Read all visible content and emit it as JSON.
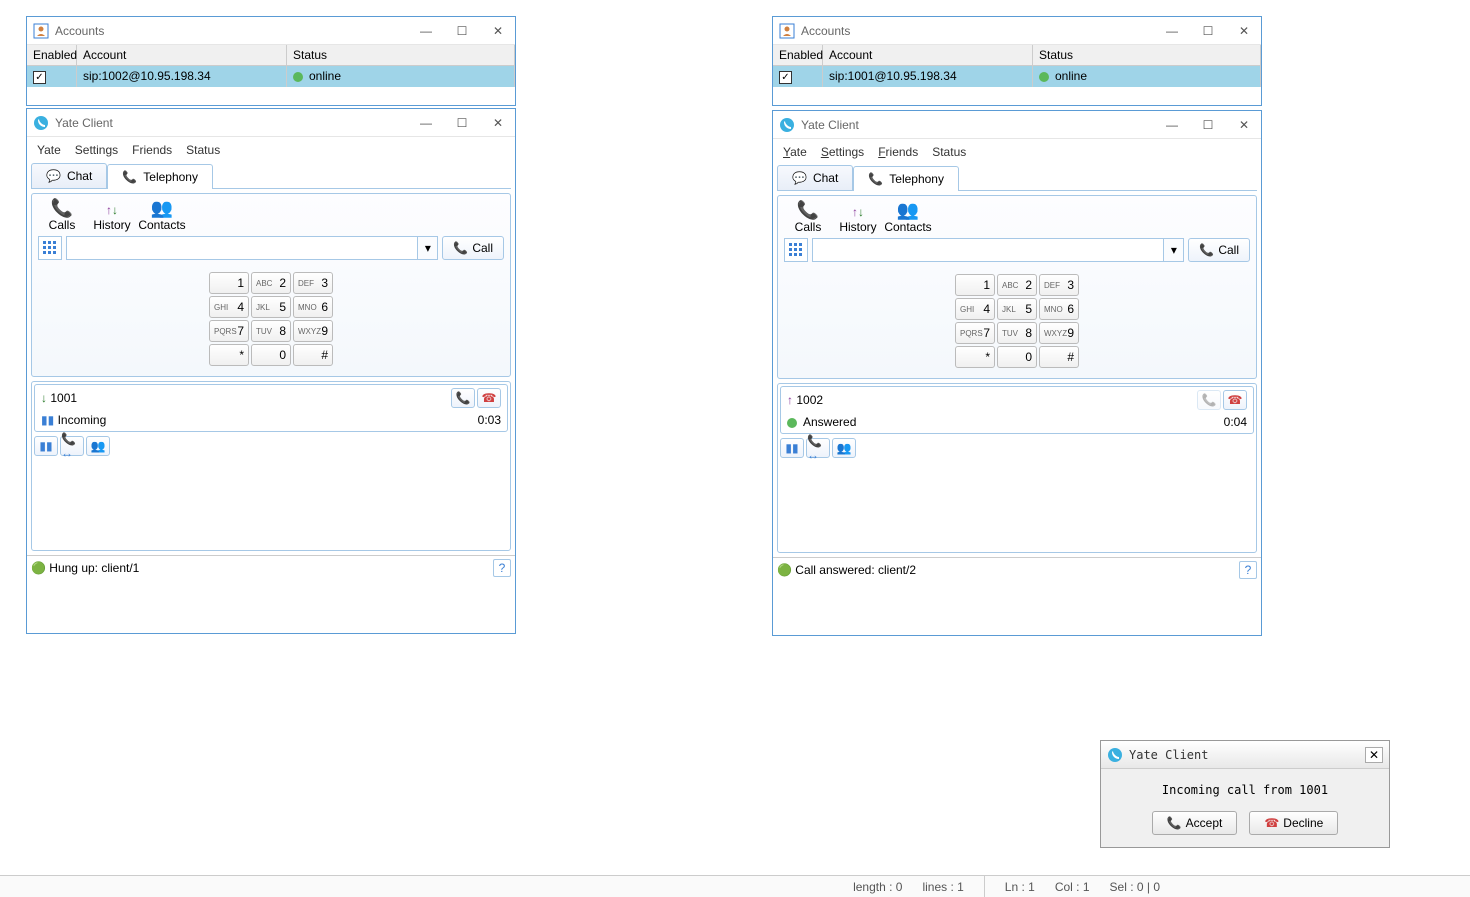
{
  "accounts_w1": {
    "title": "Accounts",
    "hdr": {
      "enabled": "Enabled",
      "account": "Account",
      "status": "Status"
    },
    "row": {
      "account": "sip:1002@10.95.198.34",
      "status": "online"
    }
  },
  "accounts_w2": {
    "title": "Accounts",
    "hdr": {
      "enabled": "Enabled",
      "account": "Account",
      "status": "Status"
    },
    "row": {
      "account": "sip:1001@10.95.198.34",
      "status": "online"
    }
  },
  "client1": {
    "title": "Yate Client",
    "menu": {
      "yate": "Yate",
      "settings": "Settings",
      "friends": "Friends",
      "status": "Status"
    },
    "tabs": {
      "chat": "Chat",
      "telephony": "Telephony"
    },
    "tools": {
      "calls": "Calls",
      "history": "History",
      "contacts": "Contacts"
    },
    "call_label": "Call",
    "keypad": [
      [
        "",
        "1",
        "ABC",
        "2",
        "DEF",
        "3"
      ],
      [
        "GHI",
        "4",
        "JKL",
        "5",
        "MNO",
        "6"
      ],
      [
        "PQRS",
        "7",
        "TUV",
        "8",
        "WXYZ",
        "9"
      ],
      [
        "",
        "*",
        "",
        "0",
        "",
        "#"
      ]
    ],
    "call": {
      "number": "1001",
      "status": "Incoming",
      "time": "0:03"
    },
    "statusbar": "Hung up: client/1"
  },
  "client2": {
    "title": "Yate Client",
    "menu": {
      "yate": "Yate",
      "settings": "Settings",
      "friends": "Friends",
      "status": "Status"
    },
    "tabs": {
      "chat": "Chat",
      "telephony": "Telephony"
    },
    "tools": {
      "calls": "Calls",
      "history": "History",
      "contacts": "Contacts"
    },
    "call_label": "Call",
    "keypad": [
      [
        "",
        "1",
        "ABC",
        "2",
        "DEF",
        "3"
      ],
      [
        "GHI",
        "4",
        "JKL",
        "5",
        "MNO",
        "6"
      ],
      [
        "PQRS",
        "7",
        "TUV",
        "8",
        "WXYZ",
        "9"
      ],
      [
        "",
        "*",
        "",
        "0",
        "",
        "#"
      ]
    ],
    "call": {
      "number": "1002",
      "status": "Answered",
      "time": "0:04"
    },
    "statusbar": "Call answered: client/2"
  },
  "dialog": {
    "title": "Yate Client",
    "msg": "Incoming call from 1001",
    "accept": "Accept",
    "decline": "Decline"
  },
  "editor": {
    "length": "length : 0",
    "lines": "lines : 1",
    "ln": "Ln : 1",
    "col": "Col : 1",
    "sel": "Sel : 0 | 0"
  }
}
